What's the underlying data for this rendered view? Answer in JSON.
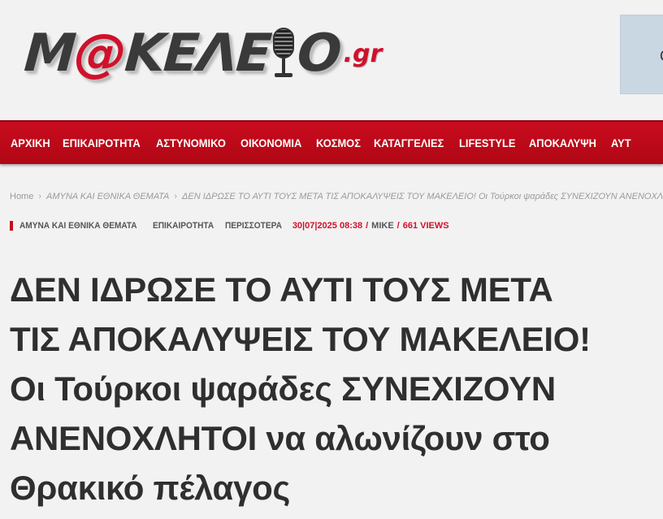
{
  "site": {
    "logo_main": "M@KEΛEIO",
    "logo_prefix": "M",
    "logo_at": "@",
    "logo_middle": "KEΛE",
    "logo_end": "O",
    "logo_tld": ".gr"
  },
  "ad": {
    "glyph": "C"
  },
  "nav": {
    "items": [
      "ΑΡΧΙΚΗ",
      "ΕΠΙΚΑΙΡΟΤΗΤΑ",
      "ΑΣΤΥΝΟΜΙΚΟ",
      "ΟΙΚΟΝΟΜΙΑ",
      "ΚΟΣΜΟΣ",
      "ΚΑΤΑΓΓΕΛΙΕΣ",
      "LIFESTYLE",
      "ΑΠΟΚΑΛΥΨΗ",
      "ΑΥΤ"
    ]
  },
  "breadcrumb": {
    "home": "Home",
    "category": "ΑΜΥΝΑ ΚΑΙ ΕΘΝΙΚΑ ΘΕΜΑΤΑ",
    "current": "ΔΕΝ ΙΔΡΩΣΕ ΤΟ ΑΥΤΙ ΤΟΥΣ ΜΕΤΑ ΤΙΣ ΑΠΟΚΑΛΥΨΕΙΣ ΤΟΥ ΜΑΚΕΛΕΙΟ! Οι Τούρκοι ψαράδες ΣΥΝΕΧΙΖΟΥΝ ΑΝΕΝΟΧΛΗΤΟΙ ν",
    "separator": "›"
  },
  "meta": {
    "tags": [
      "ΑΜΥΝΑ ΚΑΙ ΕΘΝΙΚΑ ΘΕΜΑΤΑ",
      "ΕΠΙΚΑΙΡΟΤΗΤΑ",
      "ΠΕΡΙΣΣΟΤΕΡΑ"
    ],
    "date": "30|07|2025 08:38",
    "slash": "/",
    "author": "MIKE",
    "views": "661 VIEWS"
  },
  "article": {
    "title_lines": [
      "ΔΕΝ ΙΔΡΩΣΕ ΤΟ ΑΥΤΙ ΤΟΥΣ ΜΕΤΑ",
      "ΤΙΣ ΑΠΟΚΑΛΥΨΕΙΣ ΤΟΥ ΜΑΚΕΛΕΙΟ!",
      "Οι Τούρκοι ψαράδες ΣΥΝΕΧΙΖΟΥΝ",
      "ΑΝΕΝΟΧΛΗΤΟΙ να αλωνίζουν στο",
      "Θρακικό πέλαγος"
    ]
  },
  "colors": {
    "brand_red": "#c90c1e",
    "background": "#f2f2f2",
    "title_text": "#2f2f2f"
  }
}
